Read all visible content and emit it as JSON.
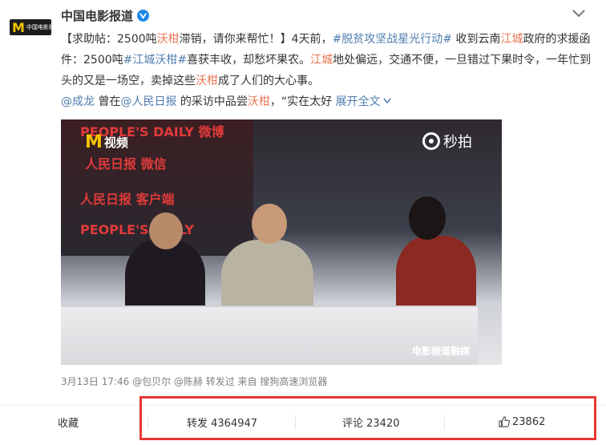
{
  "account": {
    "name": "中国电影报道",
    "avatar_text": "中国电影报道",
    "verified_icon": "verified-v-icon"
  },
  "post": {
    "text_parts": [
      {
        "t": "【求助帖：2500吨",
        "c": "n"
      },
      {
        "t": "沃柑",
        "c": "k"
      },
      {
        "t": "滞销，请你来帮忙！】4天前，",
        "c": "n"
      },
      {
        "t": "#脱贫攻坚战星光行动#",
        "c": "h"
      },
      {
        "t": " 收到云南",
        "c": "n"
      },
      {
        "t": "江城",
        "c": "k"
      },
      {
        "t": "政府的求援函件：2500吨",
        "c": "n"
      },
      {
        "t": "#江城沃柑#",
        "c": "h"
      },
      {
        "t": "喜获丰收，却愁坏果农。",
        "c": "n"
      },
      {
        "t": "江城",
        "c": "k"
      },
      {
        "t": "地处偏远，交通不便，一旦错过下果时令，一年忙到头的又是一场空，卖掉这些",
        "c": "n"
      },
      {
        "t": "沃柑",
        "c": "k"
      },
      {
        "t": "成了人们的大心事。",
        "c": "n"
      }
    ],
    "line4": {
      "mention": "@成龙",
      "t1": " 曾在",
      "mention2": "@人民日报",
      "t2": " 的采访中品尝",
      "kw": "沃柑",
      "t3": "，“实在太好 ",
      "expand": "展开全文"
    }
  },
  "video": {
    "logo_text": "视频",
    "watermark": "秒拍",
    "brands": [
      "PEOPLE'S DAILY 微博",
      "人民日报 微信",
      "人民日报 客户端",
      "PEOPLE'S DAILY"
    ],
    "caption": "电影频道融媒"
  },
  "meta": "3月13日 17:46 @包贝尔 @陈赫 转发过 来自 搜狗高速浏览器",
  "actions": {
    "favorite": "收藏",
    "repost": "转发 4364947",
    "comment": "评论 23420",
    "like": "23862"
  }
}
